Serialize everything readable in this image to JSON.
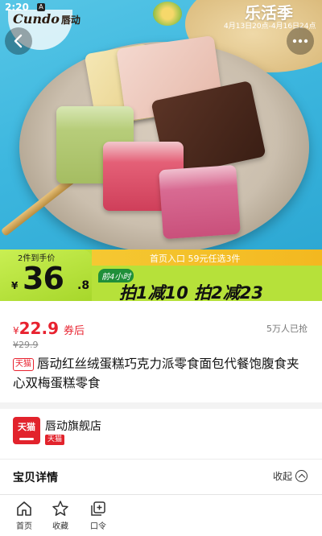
{
  "status": {
    "time": "2:20",
    "indicator": "A"
  },
  "hero": {
    "brand_latin": "Cundo",
    "brand_cn": "唇动",
    "event_title": "乐活季",
    "event_date": "4月13日20点-4月16日24点",
    "back_icon": "chevron-left-icon",
    "more_icon": "more-dots-icon"
  },
  "promo": {
    "note": "2件到手价",
    "currency": "¥",
    "price_int": "36",
    "price_dec": ".8",
    "entry": "首页入口 59元任选3件",
    "badge": "前4小时",
    "deal": "拍1减10 拍2减23",
    "colors": {
      "green": "#b6e13a",
      "yellow": "#f5c832"
    }
  },
  "price": {
    "currency": "¥",
    "amount": "22.9",
    "label": "券后",
    "original": "¥29.9",
    "sold": "5万人已抢",
    "accent": "#e8222f"
  },
  "product": {
    "tag": "天猫",
    "title": "唇动红丝绒蛋糕巧克力派零食面包代餐饱腹食夹心双梅蛋糕零食"
  },
  "shop": {
    "logo_text": "天猫",
    "name": "唇动旗舰店",
    "badge": "天猫"
  },
  "details": {
    "title": "宝贝详情",
    "collapse_label": "收起",
    "collapse_icon": "chevron-up-circle-icon"
  },
  "bottom_nav": [
    {
      "label": "首页",
      "icon": "home-icon"
    },
    {
      "label": "收藏",
      "icon": "star-icon"
    },
    {
      "label": "口令",
      "icon": "add-square-icon"
    }
  ]
}
